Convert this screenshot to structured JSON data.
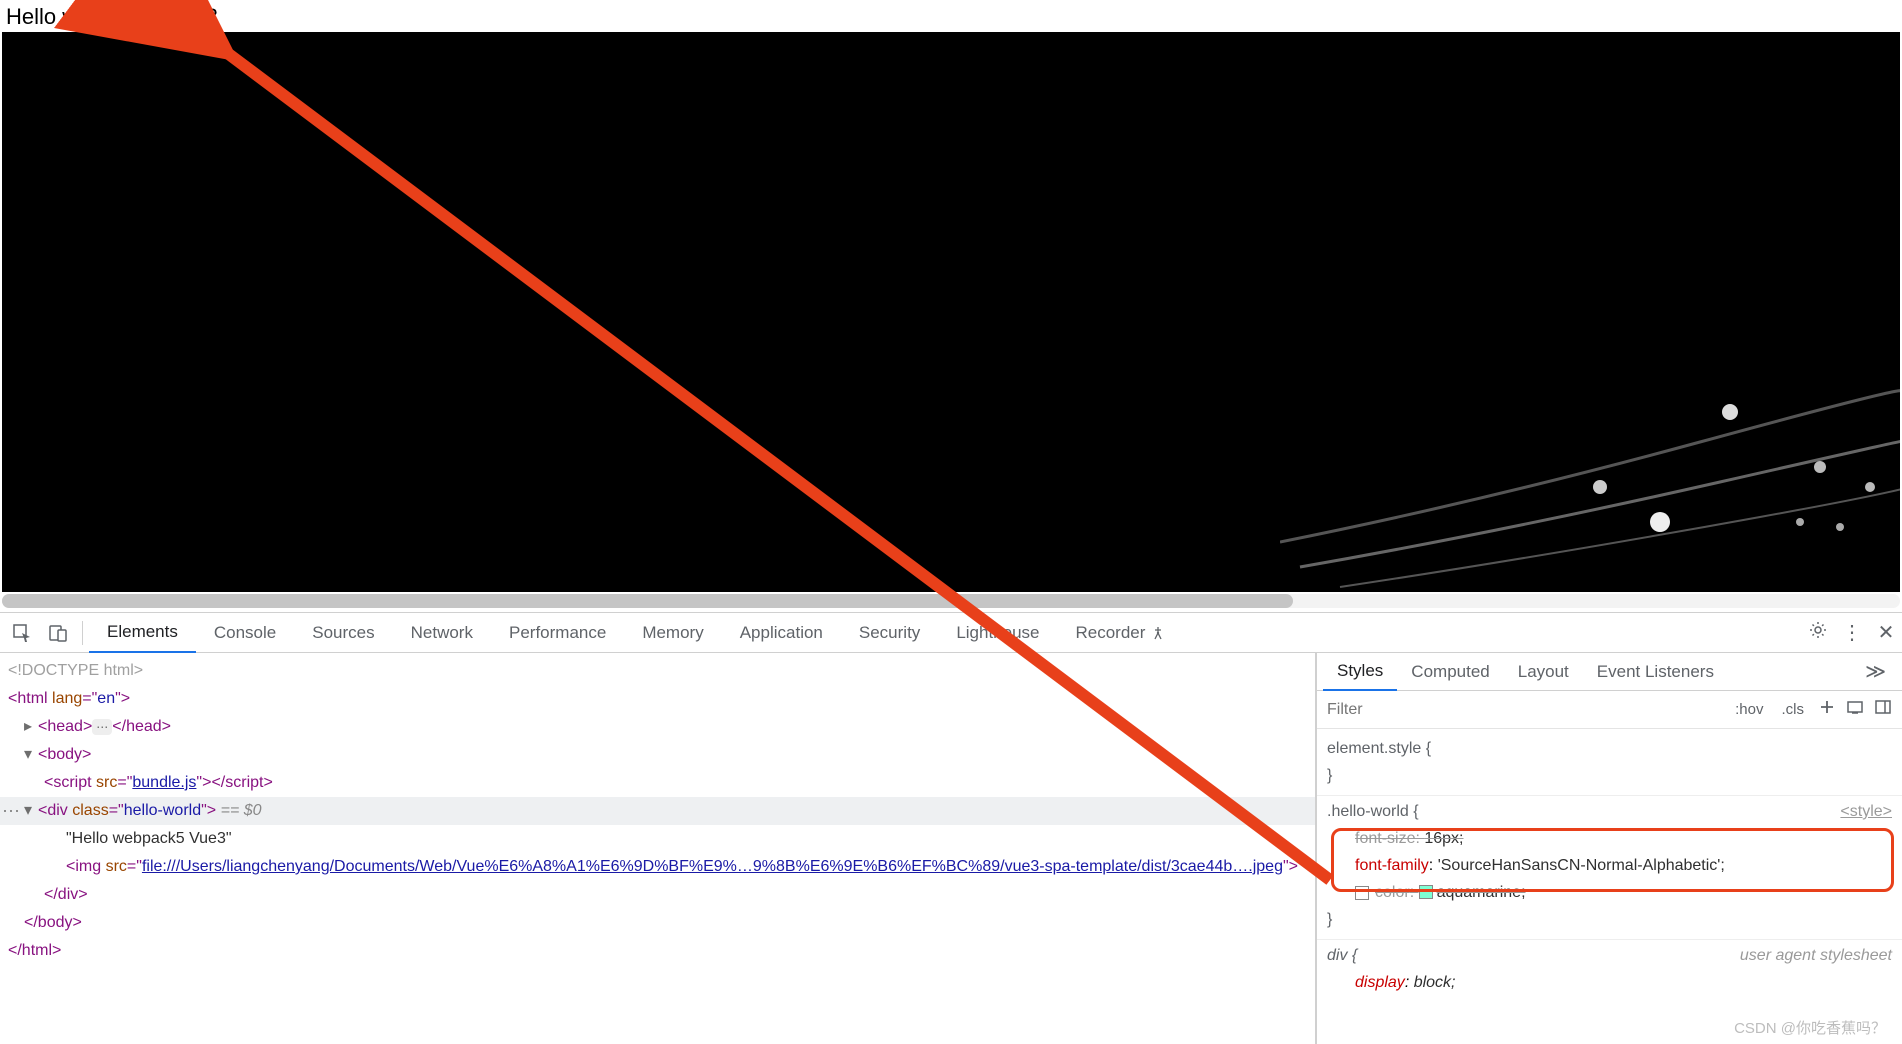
{
  "page": {
    "heading": "Hello webpack5 Vue3"
  },
  "devtools": {
    "tabs": [
      "Elements",
      "Console",
      "Sources",
      "Network",
      "Performance",
      "Memory",
      "Application",
      "Security",
      "Lighthouse",
      "Recorder"
    ],
    "activeTab": "Elements",
    "tree": {
      "doctype": "<!DOCTYPE html>",
      "htmlOpen": "<html lang=\"en\">",
      "headOpen": "<head>",
      "headClose": "</head>",
      "bodyOpen": "<body>",
      "script": {
        "tag": "script",
        "attr": "src",
        "val": "bundle.js"
      },
      "div": {
        "tag": "div",
        "attr": "class",
        "val": "hello-world",
        "eq": "== $0"
      },
      "textNode": "\"Hello webpack5 Vue3\"",
      "img": {
        "tag": "img",
        "attr": "src",
        "link1": "file:///Users/liangchenyang/Documents/Web/Vue%E6%A8%A1%E6%9D%BF%E9%…9%8B%E6%9E%B6%EF%BC%89/vue3-spa-template/dist/3cae44b….jpeg"
      },
      "divClose": "</div>",
      "bodyClose": "</body>",
      "htmlClose": "</html>"
    },
    "styles": {
      "tabs": [
        "Styles",
        "Computed",
        "Layout",
        "Event Listeners"
      ],
      "activeTab": "Styles",
      "filterPlaceholder": "Filter",
      "buttons": {
        "hov": ":hov",
        "cls": ".cls"
      },
      "rules": {
        "elementStyle": {
          "selector": "element.style {",
          "close": "}"
        },
        "helloWorld": {
          "selector": ".hello-world {",
          "origin": "<style>",
          "decl1": {
            "prop": "font-size",
            "val": "16px;"
          },
          "decl2": {
            "prop": "font-family",
            "val": "'SourceHanSansCN-Normal-Alphabetic';"
          },
          "decl3": {
            "prop": "color",
            "val": "aquamarine;"
          },
          "close": "}"
        },
        "div": {
          "selector": "div {",
          "origin": "user agent stylesheet",
          "decl1": {
            "prop": "display",
            "val": "block;"
          }
        }
      }
    }
  },
  "watermark": "CSDN @你吃香蕉吗？"
}
